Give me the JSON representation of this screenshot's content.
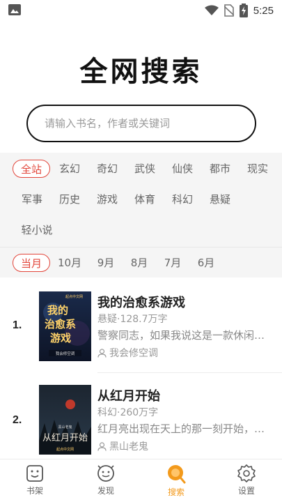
{
  "status_bar": {
    "time": "5:25"
  },
  "title": "全网搜索",
  "search": {
    "placeholder": "请输入书名，作者或关键词",
    "value": ""
  },
  "categories": [
    "全站",
    "玄幻",
    "奇幻",
    "武侠",
    "仙侠",
    "都市",
    "现实",
    "军事",
    "历史",
    "游戏",
    "体育",
    "科幻",
    "悬疑",
    "轻小说"
  ],
  "selected_category": "全站",
  "periods": [
    "当月",
    "10月",
    "9月",
    "8月",
    "7月",
    "6月"
  ],
  "selected_period": "当月",
  "accent_color": "#e2453a",
  "nav_active_color": "#f39a1c",
  "books": [
    {
      "rank": "1.",
      "title": "我的治愈系游戏",
      "meta": "悬疑·128.7万字",
      "desc": "警察同志，如果我说这是一款休闲治愈系游戏",
      "author": "我会修空调",
      "cover_title": "我的治愈系游戏",
      "cover_author": "我会修空调",
      "cover_badge": "起点中文网"
    },
    {
      "rank": "2.",
      "title": "从红月开始",
      "meta": "科幻·260万字",
      "desc": "红月亮出现在天上的那一刻开始，我就知道",
      "author": "黑山老鬼",
      "cover_title": "从红月开始",
      "cover_author": "黑山老鬼",
      "cover_badge": "起点中文网"
    }
  ],
  "bottom_nav": [
    {
      "label": "书架",
      "icon": "bookshelf-icon"
    },
    {
      "label": "发现",
      "icon": "discover-icon"
    },
    {
      "label": "搜索",
      "icon": "search-icon",
      "active": true
    },
    {
      "label": "设置",
      "icon": "settings-icon"
    }
  ]
}
